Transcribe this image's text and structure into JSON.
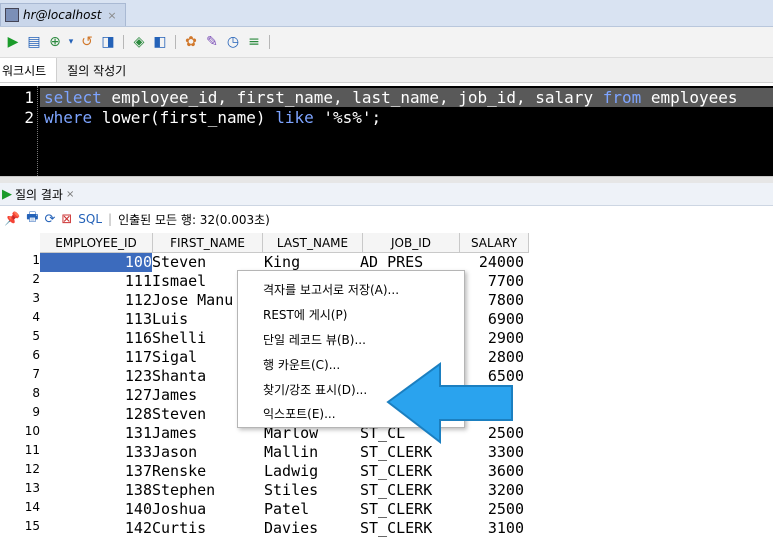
{
  "connection_tab": {
    "title": "hr@localhost",
    "close": "×"
  },
  "subtabs": [
    "워크시트",
    "질의 작성기"
  ],
  "editor": {
    "lines": [
      {
        "num": "1",
        "parts": [
          [
            "kw",
            "select"
          ],
          [
            "t",
            " employee_id, first_name, last_name, job_id, salary "
          ],
          [
            "kw",
            "from"
          ],
          [
            "t",
            " employees"
          ]
        ]
      },
      {
        "num": "2",
        "parts": [
          [
            "kw",
            "where"
          ],
          [
            "t",
            " lower(first_name) "
          ],
          [
            "kw",
            "like"
          ],
          [
            "t",
            " "
          ],
          [
            "str",
            "'%s%'"
          ],
          [
            "t",
            ";"
          ]
        ]
      }
    ]
  },
  "results_tab": {
    "label": "질의 결과",
    "close": "×"
  },
  "results_toolbar": {
    "sql_label": "SQL",
    "status": "인출된 모든 행: 32(0.003초)"
  },
  "columns": [
    "EMPLOYEE_ID",
    "FIRST_NAME",
    "LAST_NAME",
    "JOB_ID",
    "SALARY"
  ],
  "rows": [
    {
      "n": "1",
      "id": "100",
      "fn": "Steven",
      "ln": "King",
      "job": "AD_PRES",
      "sal": "24000"
    },
    {
      "n": "2",
      "id": "111",
      "fn": "Ismael",
      "ln": "",
      "job": "",
      "sal": "7700"
    },
    {
      "n": "3",
      "id": "112",
      "fn": "Jose Manu",
      "ln": "",
      "job": "",
      "sal": "7800"
    },
    {
      "n": "4",
      "id": "113",
      "fn": "Luis",
      "ln": "",
      "job": "",
      "sal": "6900"
    },
    {
      "n": "5",
      "id": "116",
      "fn": "Shelli",
      "ln": "",
      "job": "",
      "sal": "2900"
    },
    {
      "n": "6",
      "id": "117",
      "fn": "Sigal",
      "ln": "",
      "job": "",
      "sal": "2800"
    },
    {
      "n": "7",
      "id": "123",
      "fn": "Shanta",
      "ln": "",
      "job": "",
      "sal": "6500"
    },
    {
      "n": "8",
      "id": "127",
      "fn": "James",
      "ln": "",
      "job": "",
      "sal": ""
    },
    {
      "n": "9",
      "id": "128",
      "fn": "Steven",
      "ln": "",
      "job": "",
      "sal": ""
    },
    {
      "n": "10",
      "id": "131",
      "fn": "James",
      "ln": "Marlow",
      "job": "ST_CL",
      "sal": "2500"
    },
    {
      "n": "11",
      "id": "133",
      "fn": "Jason",
      "ln": "Mallin",
      "job": "ST_CLERK",
      "sal": "3300"
    },
    {
      "n": "12",
      "id": "137",
      "fn": "Renske",
      "ln": "Ladwig",
      "job": "ST_CLERK",
      "sal": "3600"
    },
    {
      "n": "13",
      "id": "138",
      "fn": "Stephen",
      "ln": "Stiles",
      "job": "ST_CLERK",
      "sal": "3200"
    },
    {
      "n": "14",
      "id": "140",
      "fn": "Joshua",
      "ln": "Patel",
      "job": "ST_CLERK",
      "sal": "2500"
    },
    {
      "n": "15",
      "id": "142",
      "fn": "Curtis",
      "ln": "Davies",
      "job": "ST_CLERK",
      "sal": "3100"
    }
  ],
  "context_menu": [
    {
      "label": "격자를 보고서로 저장(A)..."
    },
    {
      "label": "REST에 게시(P)"
    },
    {
      "label": "단일 레코드 뷰(B)..."
    },
    {
      "label": "행 카운트(C)..."
    },
    {
      "label": "찾기/강조 표시(D)..."
    },
    {
      "label": "익스포트(E)..."
    }
  ],
  "colors": {
    "arrow": "#2aa3ee",
    "selection": "#3c6bbd",
    "keyword": "#7da4ff"
  }
}
